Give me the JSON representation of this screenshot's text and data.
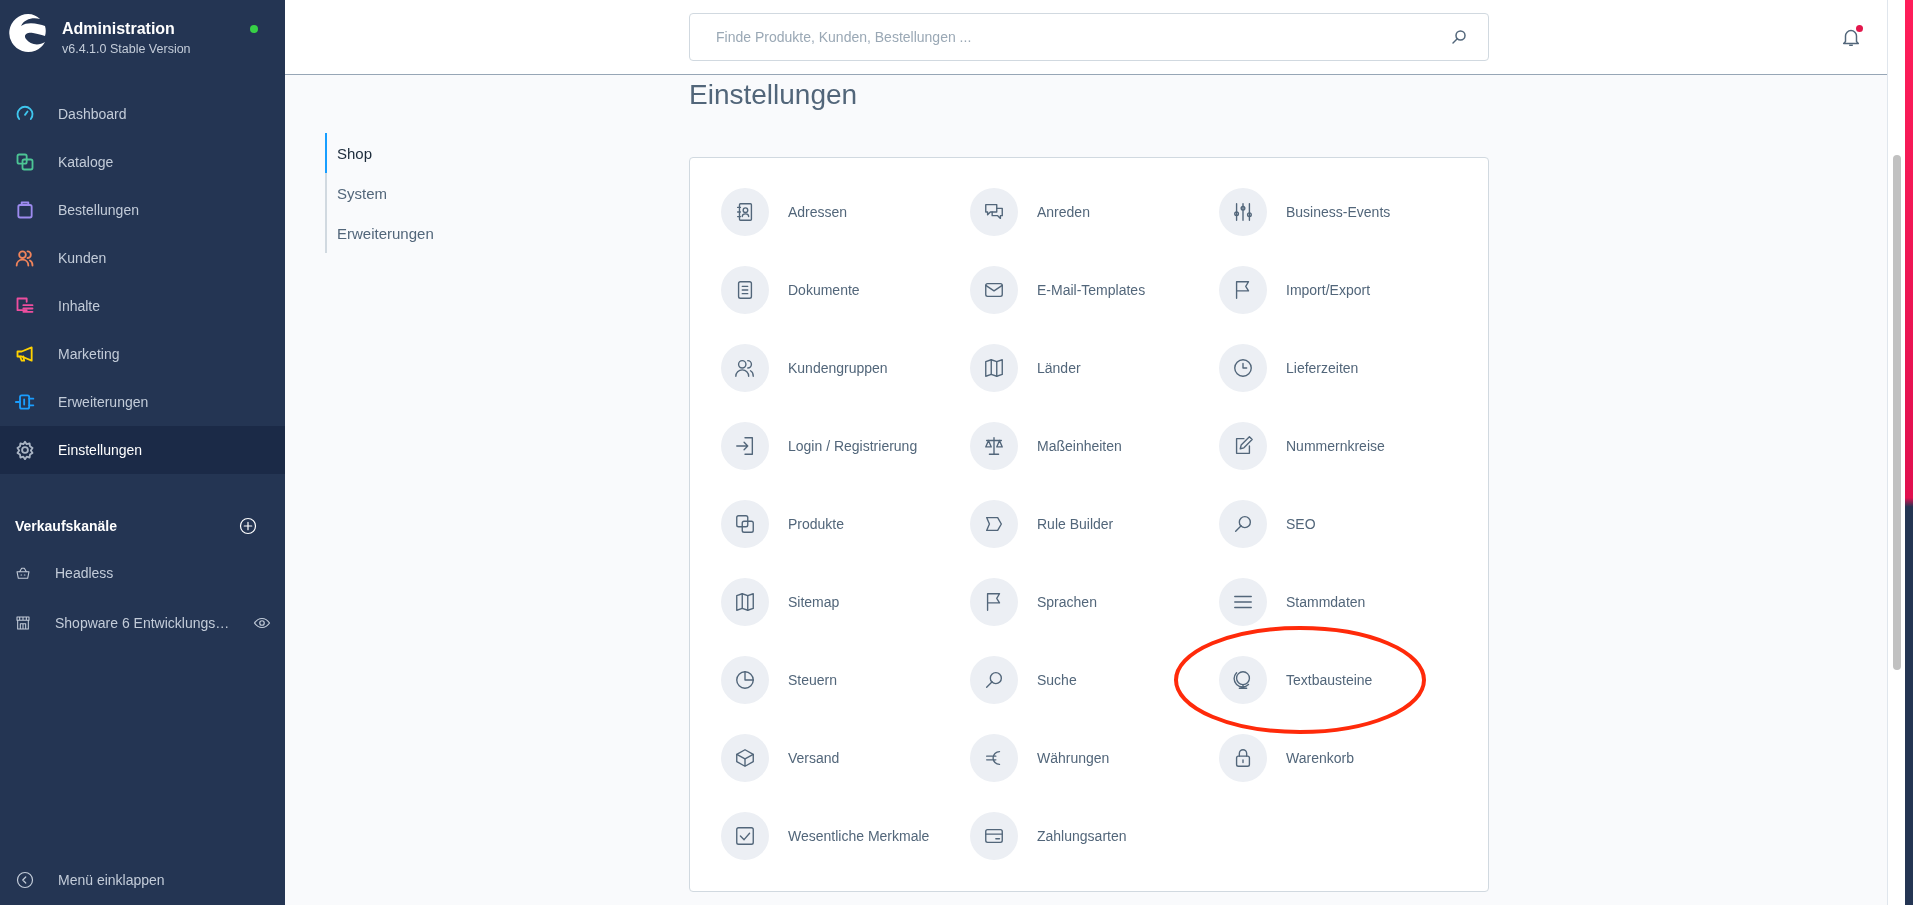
{
  "brand": {
    "title": "Administration",
    "version": "v6.4.1.0 Stable Version",
    "online": true
  },
  "nav": {
    "items": [
      {
        "label": "Dashboard",
        "color": "#3fc6ee",
        "selected": false
      },
      {
        "label": "Kataloge",
        "color": "#4cc595",
        "selected": false
      },
      {
        "label": "Bestellungen",
        "color": "#9d8bef",
        "selected": false
      },
      {
        "label": "Kunden",
        "color": "#f1845b",
        "selected": false
      },
      {
        "label": "Inhalte",
        "color": "#ee4e9f",
        "selected": false
      },
      {
        "label": "Marketing",
        "color": "#ffd200",
        "selected": false
      },
      {
        "label": "Erweiterungen",
        "color": "#1a9dfd",
        "selected": false
      },
      {
        "label": "Einstellungen",
        "color": "#a9b4c4",
        "selected": true
      }
    ]
  },
  "sales_channels": {
    "title": "Verkaufskanäle",
    "items": [
      {
        "label": "Headless",
        "kind": "headless",
        "visible_link": false
      },
      {
        "label": "Shopware 6 Entwicklungs…",
        "kind": "storefront",
        "visible_link": true
      }
    ]
  },
  "collapse": {
    "label": "Menü einklappen"
  },
  "search": {
    "placeholder": "Finde Produkte, Kunden, Bestellungen ..."
  },
  "notifications": {
    "unread": true
  },
  "page": {
    "title": "Einstellungen"
  },
  "tabs": [
    {
      "label": "Shop",
      "selected": true
    },
    {
      "label": "System",
      "selected": false
    },
    {
      "label": "Erweiterungen",
      "selected": false
    }
  ],
  "settings": [
    {
      "label": "Adressen",
      "highlighted": false
    },
    {
      "label": "Anreden",
      "highlighted": false
    },
    {
      "label": "Business-Events",
      "highlighted": false
    },
    {
      "label": "Dokumente",
      "highlighted": false
    },
    {
      "label": "E-Mail-Templates",
      "highlighted": false
    },
    {
      "label": "Import/Export",
      "highlighted": false
    },
    {
      "label": "Kundengruppen",
      "highlighted": false
    },
    {
      "label": "Länder",
      "highlighted": false
    },
    {
      "label": "Lieferzeiten",
      "highlighted": false
    },
    {
      "label": "Login / Registrierung",
      "highlighted": false
    },
    {
      "label": "Maßeinheiten",
      "highlighted": false
    },
    {
      "label": "Nummernkreise",
      "highlighted": false
    },
    {
      "label": "Produkte",
      "highlighted": false
    },
    {
      "label": "Rule Builder",
      "highlighted": false
    },
    {
      "label": "SEO",
      "highlighted": false
    },
    {
      "label": "Sitemap",
      "highlighted": false
    },
    {
      "label": "Sprachen",
      "highlighted": false
    },
    {
      "label": "Stammdaten",
      "highlighted": false
    },
    {
      "label": "Steuern",
      "highlighted": false
    },
    {
      "label": "Suche",
      "highlighted": false
    },
    {
      "label": "Textbausteine",
      "highlighted": true
    },
    {
      "label": "Versand",
      "highlighted": false
    },
    {
      "label": "Währungen",
      "highlighted": false
    },
    {
      "label": "Warenkorb",
      "highlighted": false
    },
    {
      "label": "Wesentliche Merkmale",
      "highlighted": false
    },
    {
      "label": "Zahlungsarten",
      "highlighted": false
    }
  ]
}
